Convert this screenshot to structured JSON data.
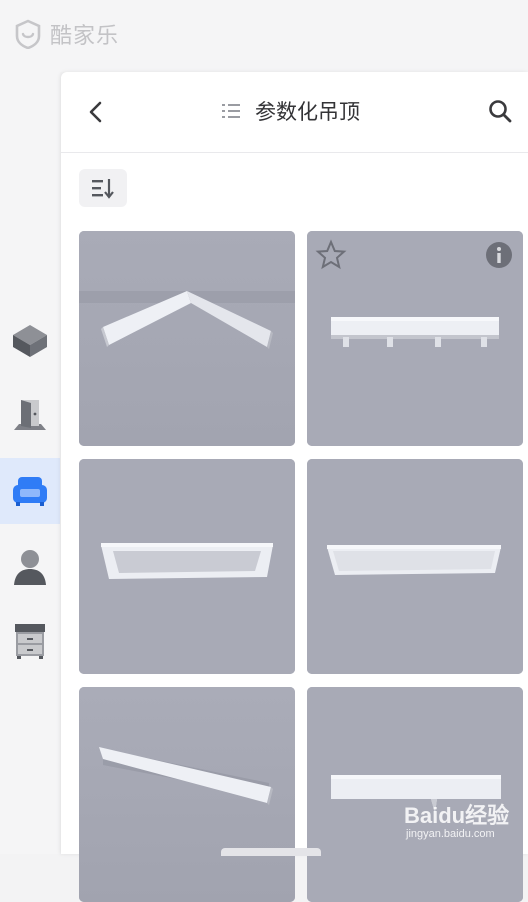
{
  "app": {
    "logo_text": "酷家乐"
  },
  "header": {
    "title": "参数化吊顶"
  },
  "icons": {
    "back": "chevron-left-icon",
    "list": "list-icon",
    "search": "search-icon",
    "sort": "sort-icon",
    "favorite": "star-outline-icon",
    "info": "info-icon"
  },
  "rail": {
    "items": [
      {
        "name": "hard-decoration",
        "icon": "cube-icon",
        "active": false
      },
      {
        "name": "door-window",
        "icon": "door-icon",
        "active": false
      },
      {
        "name": "furniture",
        "icon": "sofa-icon",
        "active": true
      },
      {
        "name": "personal",
        "icon": "person-icon",
        "active": false
      },
      {
        "name": "cabinet",
        "icon": "cabinet-icon",
        "active": false
      }
    ]
  },
  "grid": {
    "items": [
      {
        "model": "ceiling-model-1"
      },
      {
        "model": "ceiling-model-2"
      },
      {
        "model": "ceiling-model-3"
      },
      {
        "model": "ceiling-model-4"
      },
      {
        "model": "ceiling-model-5"
      },
      {
        "model": "ceiling-model-6"
      }
    ]
  },
  "watermark": {
    "main": "Baidu经验",
    "sub": "jingyan.baidu.com"
  },
  "colors": {
    "accent": "#2f7cf6",
    "tile_bg": "#a6a8b4",
    "rail_active": "#dfe9fb"
  }
}
